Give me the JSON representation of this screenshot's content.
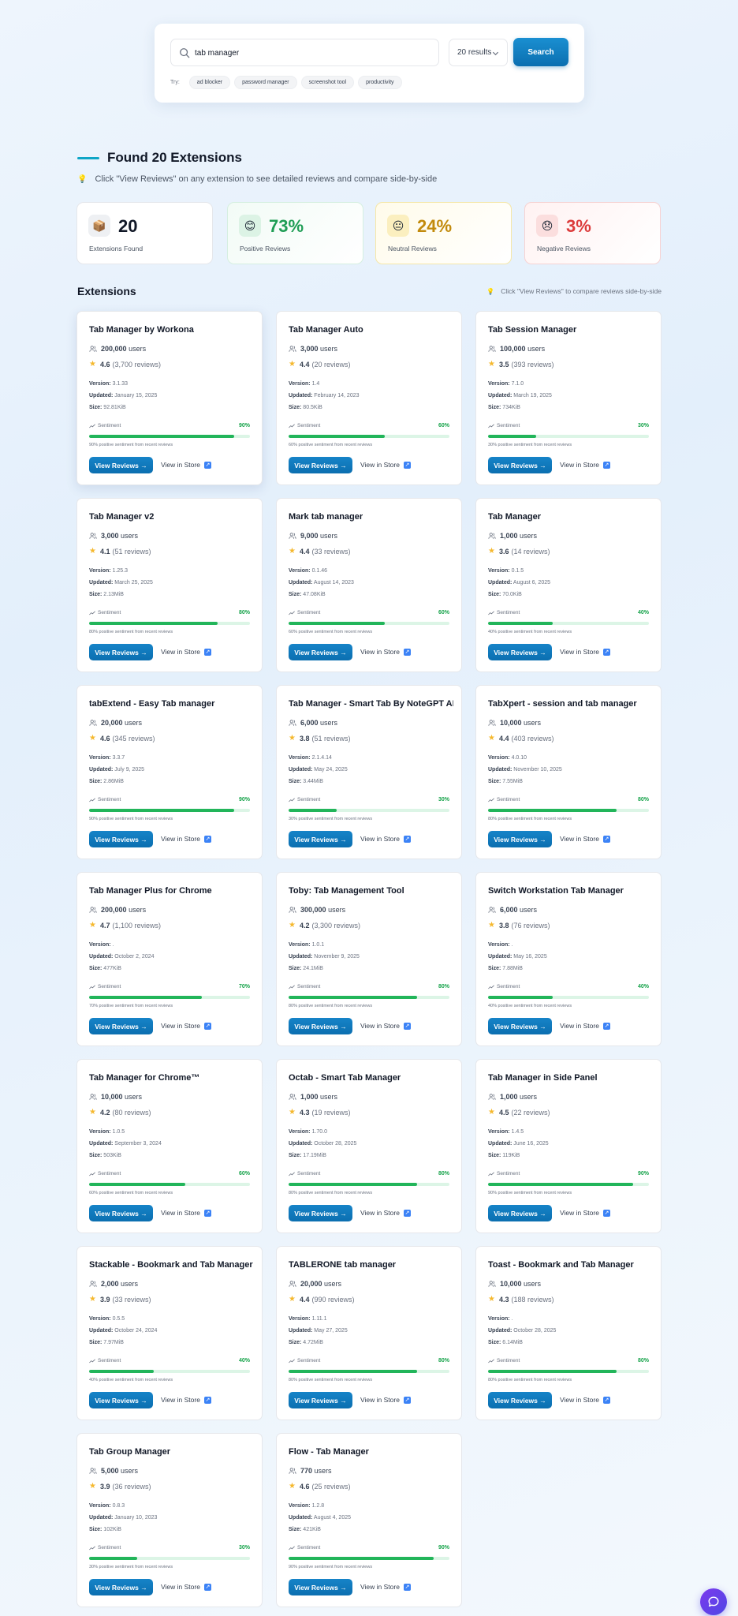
{
  "search": {
    "value": "tab manager",
    "results_select": "20 results",
    "button": "Search",
    "try_label": "Try:",
    "suggestions": [
      "ad blocker",
      "password manager",
      "screenshot tool",
      "productivity"
    ]
  },
  "header": {
    "title": "Found 20 Extensions",
    "hint": "Click \"View Reviews\" on any extension to see detailed reviews and compare side-by-side"
  },
  "stats": [
    {
      "value": "20",
      "label": "Extensions Found",
      "color": "#111827",
      "emoji": "📦"
    },
    {
      "value": "73%",
      "label": "Positive Reviews",
      "color": "#1f9d55",
      "emoji": "😊"
    },
    {
      "value": "24%",
      "label": "Neutral Reviews",
      "color": "#c28a0c",
      "emoji": "😐"
    },
    {
      "value": "3%",
      "label": "Negative Reviews",
      "color": "#dc3b3b",
      "emoji": "😞"
    }
  ],
  "extensions_section": {
    "title": "Extensions",
    "hint": "Click \"View Reviews\" to compare reviews side-by-side"
  },
  "card_labels": {
    "users_suffix": "users",
    "reviews_suffix": "reviews",
    "version": "Version:",
    "updated": "Updated:",
    "size": "Size:",
    "sentiment": "Sentiment",
    "positive_note": "positive sentiment from recent reviews",
    "view_reviews": "View Reviews →",
    "view_store": "View in Store"
  },
  "extensions": [
    {
      "name": "Tab Manager by Workona",
      "users": "200,000",
      "rating": "4.6",
      "reviews": "3,700",
      "version": "3.1.33",
      "updated": "January 15, 2025",
      "size": "92.81KiB",
      "sentiment": 90
    },
    {
      "name": "Tab Manager Auto",
      "users": "3,000",
      "rating": "4.4",
      "reviews": "20",
      "version": "1.4",
      "updated": "February 14, 2023",
      "size": "80.5KiB",
      "sentiment": 60
    },
    {
      "name": "Tab Session Manager",
      "users": "100,000",
      "rating": "3.5",
      "reviews": "393",
      "version": "7.1.0",
      "updated": "March 19, 2025",
      "size": "734KiB",
      "sentiment": 30
    },
    {
      "name": "Tab Manager v2",
      "users": "3,000",
      "rating": "4.1",
      "reviews": "51",
      "version": "1.25.3",
      "updated": "March 25, 2025",
      "size": "2.13MiB",
      "sentiment": 80
    },
    {
      "name": "Mark tab manager",
      "users": "9,000",
      "rating": "4.4",
      "reviews": "33",
      "version": "0.1.46",
      "updated": "August 14, 2023",
      "size": "47.08KiB",
      "sentiment": 60
    },
    {
      "name": "Tab Manager",
      "users": "1,000",
      "rating": "3.6",
      "reviews": "14",
      "version": "0.1.5",
      "updated": "August 6, 2025",
      "size": "70.0KiB",
      "sentiment": 40
    },
    {
      "name": "tabExtend - Easy Tab manager",
      "users": "20,000",
      "rating": "4.6",
      "reviews": "345",
      "version": "3.3.7",
      "updated": "July 9, 2025",
      "size": "2.86MiB",
      "sentiment": 90
    },
    {
      "name": "Tab Manager - Smart Tab By NoteGPT AI",
      "users": "6,000",
      "rating": "3.8",
      "reviews": "51",
      "version": "2.1.4.14",
      "updated": "May 24, 2025",
      "size": "3.44MiB",
      "sentiment": 30
    },
    {
      "name": "TabXpert - session and tab manager",
      "users": "10,000",
      "rating": "4.4",
      "reviews": "403",
      "version": "4.0.10",
      "updated": "November 10, 2025",
      "size": "7.55MiB",
      "sentiment": 80
    },
    {
      "name": "Tab Manager Plus for Chrome",
      "users": "200,000",
      "rating": "4.7",
      "reviews": "1,100",
      "version": ".",
      "updated": "October 2, 2024",
      "size": "477KiB",
      "sentiment": 70
    },
    {
      "name": "Toby: Tab Management Tool",
      "users": "300,000",
      "rating": "4.2",
      "reviews": "3,300",
      "version": "1.0.1",
      "updated": "November 9, 2025",
      "size": "24.1MiB",
      "sentiment": 80
    },
    {
      "name": "Switch Workstation Tab Manager",
      "users": "6,000",
      "rating": "3.8",
      "reviews": "76",
      "version": ".",
      "updated": "May 16, 2025",
      "size": "7.88MiB",
      "sentiment": 40
    },
    {
      "name": "Tab Manager for Chrome™",
      "users": "10,000",
      "rating": "4.2",
      "reviews": "80",
      "version": "1.0.5",
      "updated": "September 3, 2024",
      "size": "503KiB",
      "sentiment": 60
    },
    {
      "name": "Octab - Smart Tab Manager",
      "users": "1,000",
      "rating": "4.3",
      "reviews": "19",
      "version": "1.70.0",
      "updated": "October 28, 2025",
      "size": "17.19MiB",
      "sentiment": 80
    },
    {
      "name": "Tab Manager in Side Panel",
      "users": "1,000",
      "rating": "4.5",
      "reviews": "22",
      "version": "1.4.5",
      "updated": "June 16, 2025",
      "size": "119KiB",
      "sentiment": 90
    },
    {
      "name": "Stackable - Bookmark and Tab Manager",
      "users": "2,000",
      "rating": "3.9",
      "reviews": "33",
      "version": "0.5.5",
      "updated": "October 24, 2024",
      "size": "7.97MiB",
      "sentiment": 40
    },
    {
      "name": "TABLERONE tab manager",
      "users": "20,000",
      "rating": "4.4",
      "reviews": "990",
      "version": "1.11.1",
      "updated": "May 27, 2025",
      "size": "4.72MiB",
      "sentiment": 80
    },
    {
      "name": "Toast - Bookmark and Tab Manager",
      "users": "10,000",
      "rating": "4.3",
      "reviews": "188",
      "version": ".",
      "updated": "October 28, 2025",
      "size": "6.14MiB",
      "sentiment": 80
    },
    {
      "name": "Tab Group Manager",
      "users": "5,000",
      "rating": "3.9",
      "reviews": "36",
      "version": "0.8.3",
      "updated": "January 10, 2023",
      "size": "102KiB",
      "sentiment": 30
    },
    {
      "name": "Flow - Tab Manager",
      "users": "770",
      "rating": "4.6",
      "reviews": "25",
      "version": "1.2.8",
      "updated": "August 4, 2025",
      "size": "421KiB",
      "sentiment": 90
    }
  ]
}
